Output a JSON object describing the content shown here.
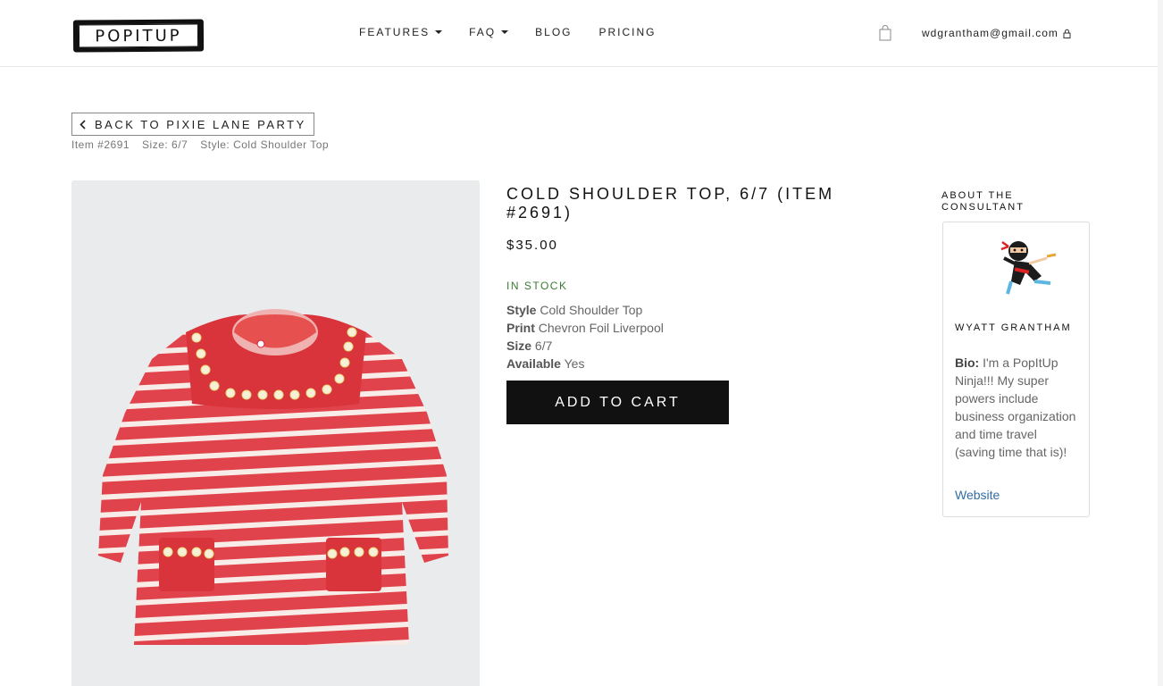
{
  "header": {
    "logo_text": "POPITUP",
    "nav": [
      {
        "label": "FEATURES",
        "has_dropdown": true
      },
      {
        "label": "FAQ",
        "has_dropdown": true
      },
      {
        "label": "BLOG",
        "has_dropdown": false
      },
      {
        "label": "PRICING",
        "has_dropdown": false
      }
    ],
    "cart_icon": "shopping-bag-icon",
    "user_email": "wdgrantham@gmail.com",
    "user_icon": "lock-icon"
  },
  "back": {
    "label": "BACK TO PIXIE LANE PARTY",
    "icon": "chevron-left-icon"
  },
  "meta": {
    "item": "Item #2691",
    "size": "Size: 6/7",
    "style": "Style: Cold Shoulder Top"
  },
  "product": {
    "title": "COLD SHOULDER TOP, 6/7 (ITEM #2691)",
    "price": "$35.00",
    "stock": "IN STOCK",
    "attributes": [
      {
        "label": "Style",
        "value": "Cold Shoulder Top"
      },
      {
        "label": "Print",
        "value": "Chevron Foil Liverpool"
      },
      {
        "label": "Size",
        "value": "6/7"
      },
      {
        "label": "Available",
        "value": "Yes"
      }
    ],
    "add_to_cart": "ADD TO CART",
    "colors": {
      "stock": "#3c7a34",
      "dress_red": "#e0434b",
      "button": "#111111"
    }
  },
  "consultant": {
    "heading": "ABOUT THE CONSULTANT",
    "name": "WYATT GRANTHAM",
    "bio_label": "Bio:",
    "bio_text": "I'm a PopItUp Ninja!!! My super powers include business organization and time travel (saving time that is)!",
    "website_label": "Website",
    "avatar_icon": "ninja-avatar"
  }
}
